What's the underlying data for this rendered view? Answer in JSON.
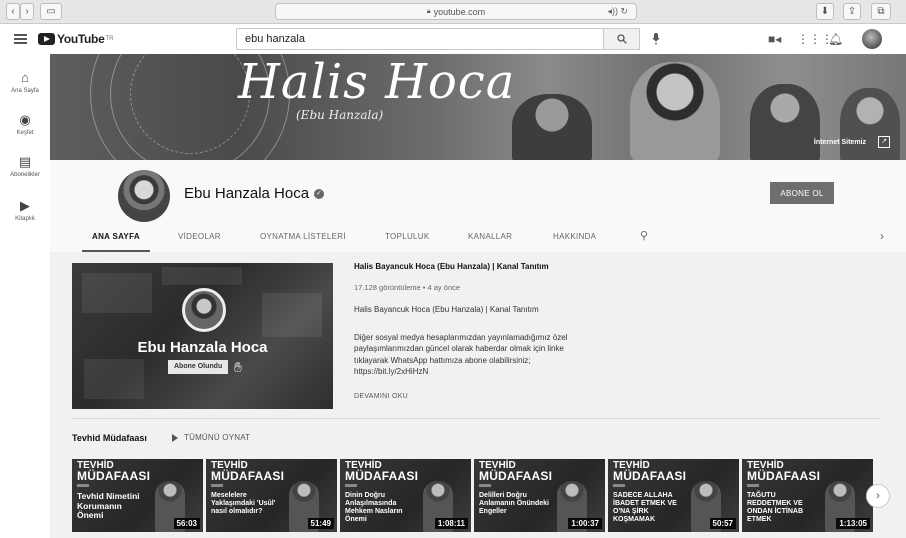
{
  "browser": {
    "url": "youtube.com",
    "back": "‹",
    "forward": "›"
  },
  "topbar": {
    "logo_text": "YouTube",
    "logo_sup": "TR",
    "search_value": "ebu hanzala"
  },
  "leftnav": {
    "items": [
      {
        "label": "Ana Sayfa",
        "icon": "home-icon"
      },
      {
        "label": "Keşfet",
        "icon": "explore-icon"
      },
      {
        "label": "Abonelikler",
        "icon": "subscriptions-icon"
      },
      {
        "label": "Kitaplık",
        "icon": "library-icon"
      }
    ]
  },
  "banner": {
    "title": "Halis Hoca",
    "subtitle": "(Ebu Hanzala)",
    "link": "İnternet Sitemiz"
  },
  "channel": {
    "name": "Ebu Hanzala Hoca",
    "subscribe_label": "ABONE OL",
    "tabs": [
      "ANA SAYFA",
      "VİDEOLAR",
      "OYNATMA LİSTELERİ",
      "TOPLULUK",
      "KANALLAR",
      "HAKKINDA"
    ]
  },
  "featured": {
    "thumb_title": "Ebu Hanzala Hoca",
    "thumb_badge": "Abone Olundu",
    "title": "Halis Bayancuk Hoca (Ebu Hanzala) | Kanal Tanıtım",
    "meta": "17.128 görüntüleme • 4 ay önce",
    "line": "Halis Bayancuk Hoca (Ebu Hanzala) | Kanal Tanıtım",
    "desc_1": "Diğer sosyal medya hesaplarımızdan yayınlamadığımız özel",
    "desc_2": "paylaşımlarımızdan güncel olarak haberdar olmak için linke",
    "desc_3": "tıklayarak WhatsApp hattımıza abone olabilirsiniz;",
    "desc_4": "https://bit.ly/2xHiHzN",
    "more": "DEVAMINI OKU"
  },
  "shelf": {
    "title": "Tevhid Müdafaası",
    "play_all": "TÜMÜNÜ OYNAT",
    "series_line1": "TEVHİD",
    "series_line2": "MÜDAFAASI",
    "videos": [
      {
        "title": "Tevhid Nimetini Korumanın Önemi",
        "duration": "56:03"
      },
      {
        "title": "Meselelere Yaklaşımdaki 'Usûl' nasıl olmalıdır?",
        "duration": "51:49"
      },
      {
        "title": "Dinin Doğru Anlaşılmasında Mehkem Nasların Önemi",
        "duration": "1:08:11"
      },
      {
        "title": "Delilleri Doğru Anlamanın Önündeki Engeller",
        "duration": "1:00:37"
      },
      {
        "title": "SADECE ALLAHA İBADET ETMEK VE O'NA ŞİRK KOŞMAMAK",
        "duration": "50:57"
      },
      {
        "title": "TAĞUTU REDDETMEK VE ONDAN İCTİNAB ETMEK",
        "duration": "1:13:05"
      }
    ]
  }
}
